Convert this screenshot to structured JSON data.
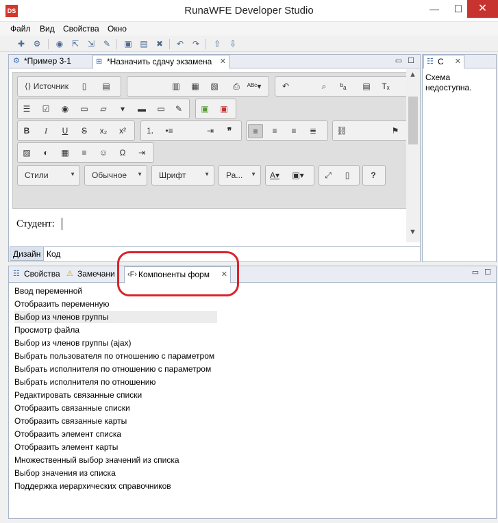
{
  "window": {
    "title": "RunaWFE Developer Studio",
    "icon_text": "DS",
    "min": "—",
    "max": "☐",
    "close": "✕"
  },
  "menu": {
    "items": [
      "Файл",
      "Вид",
      "Свойства",
      "Окно"
    ]
  },
  "toolbar_icons": [
    "new-icon",
    "settings-icon",
    "globe-icon",
    "deploy-icon",
    "import-icon",
    "export-icon",
    "save-icon",
    "save-all-icon",
    "delete-icon",
    "undo-icon",
    "redo-icon",
    "upload-icon",
    "download-icon"
  ],
  "editor_tabs": [
    {
      "label": "*Пример 3-1",
      "active": false
    },
    {
      "label": "*Назначить сдачу экзамена",
      "active": true
    }
  ],
  "ck_toolbar": {
    "source_label": "Источник",
    "styles_label": "Стили",
    "format_label": "Обычное",
    "font_label": "Шрифт",
    "size_label": "Ра..."
  },
  "content": {
    "text": "Студент:"
  },
  "mode_tabs": [
    "Дизайн",
    "Код"
  ],
  "side": {
    "tab_label": "С",
    "text": "Схема недоступна."
  },
  "bottom_tabs": [
    {
      "label": "Свойства"
    },
    {
      "label": "Замечани"
    },
    {
      "label": "Компоненты форм",
      "active": true
    }
  ],
  "components": [
    "Ввод переменной",
    "Отобразить переменную",
    "Выбор из членов группы",
    "Просмотр файла",
    "Выбор из членов группы (ajax)",
    "Выбрать пользователя по отношению с параметром",
    "Выбрать исполнителя по отношению с параметром",
    "Выбрать исполнителя по отношению",
    "Редактировать связанные списки",
    "Отобразить связанные списки",
    "Отобразить связанные карты",
    "Отобразить элемент списка",
    "Отобразить элемент карты",
    "Множественный выбор значений из списка",
    "Выбор значения из списка",
    "Поддержка иерархических справочников"
  ],
  "selected_component_index": 2,
  "colors": {
    "highlight": "#d8232a",
    "close_bg": "#c7342f",
    "tab_border": "#a9b6c8"
  }
}
